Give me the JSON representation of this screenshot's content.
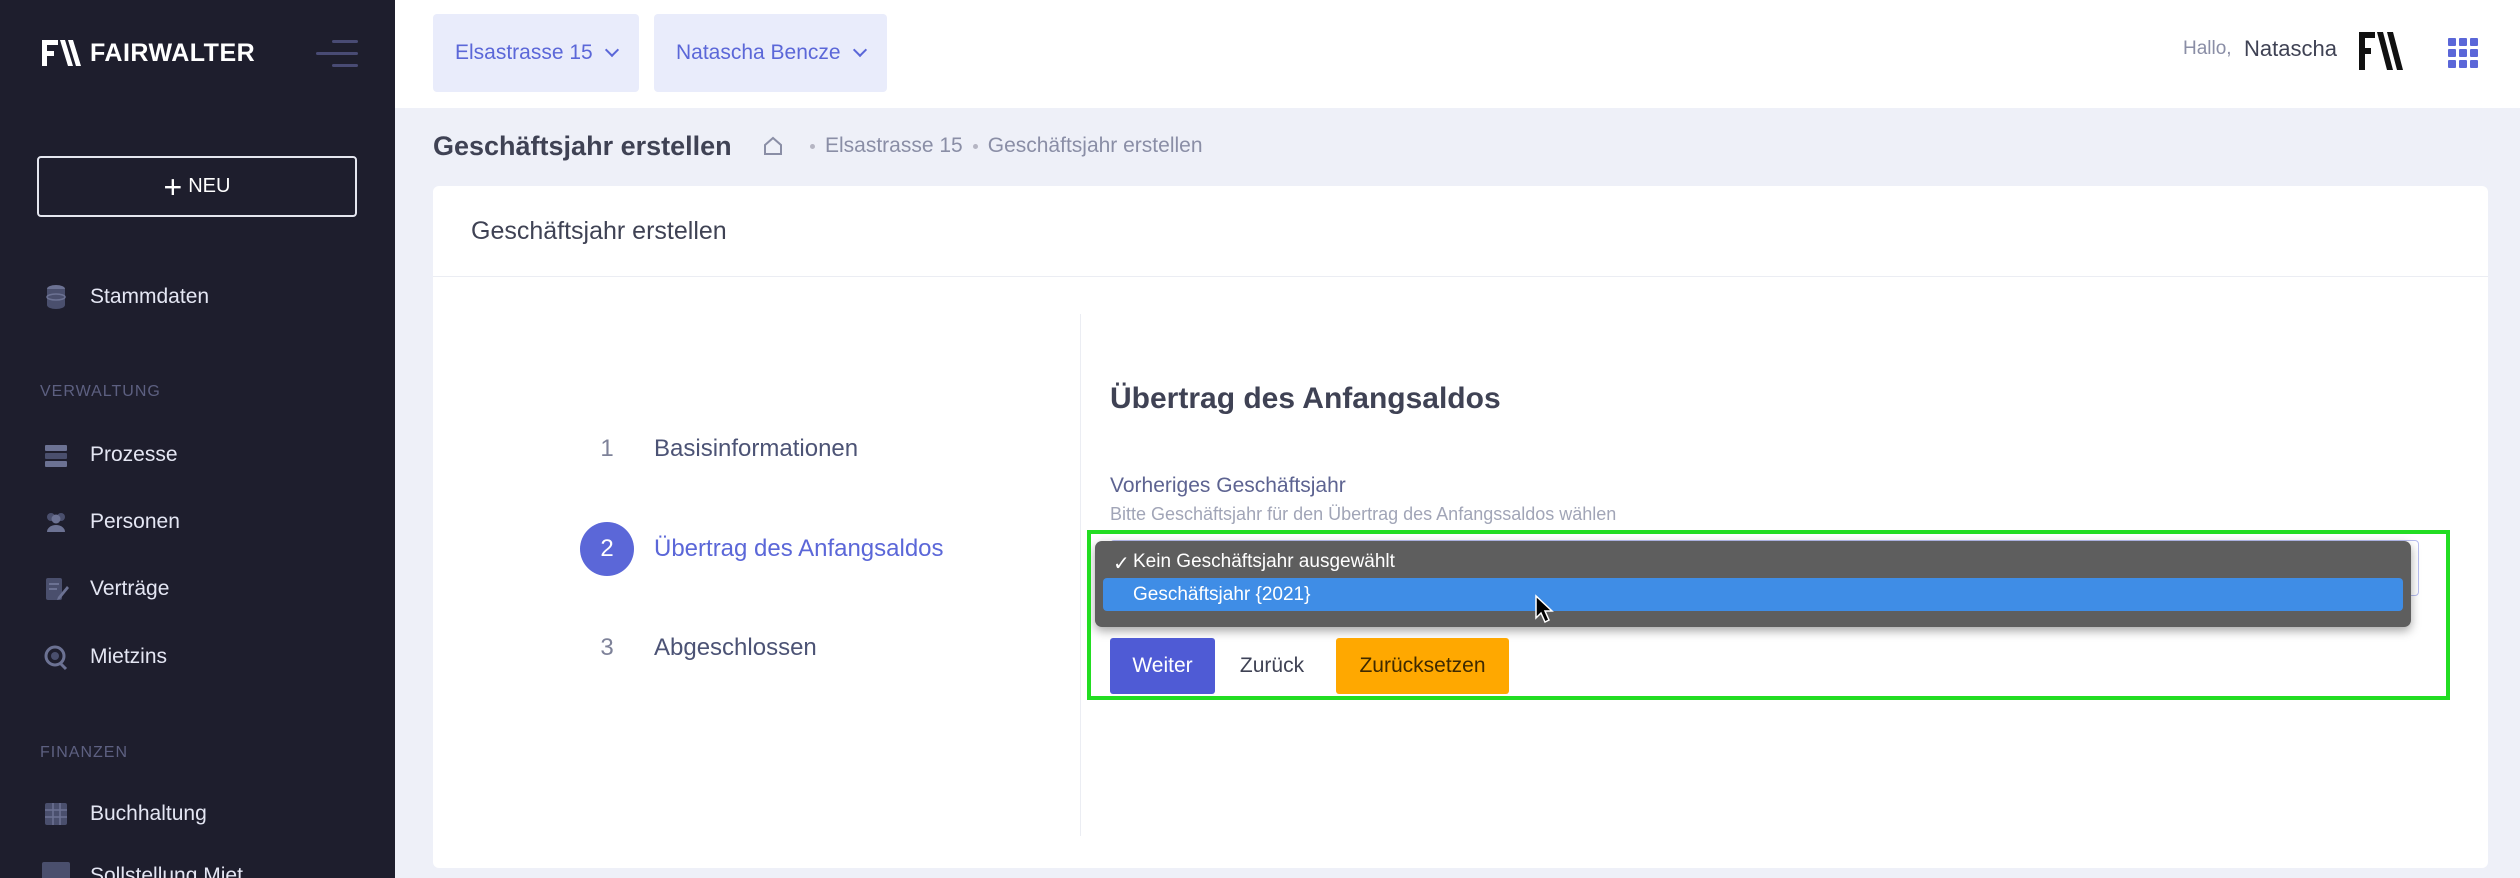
{
  "brand": {
    "name": "FAIRWALTER"
  },
  "sidebar": {
    "new_button": "NEU",
    "items": [
      {
        "label": "Stammdaten",
        "icon": "database-icon"
      },
      {
        "label": "Prozesse",
        "icon": "server-icon"
      },
      {
        "label": "Personen",
        "icon": "users-icon"
      },
      {
        "label": "Verträge",
        "icon": "contract-icon"
      },
      {
        "label": "Mietzins",
        "icon": "money-icon"
      },
      {
        "label": "Buchhaltung",
        "icon": "ledger-icon"
      },
      {
        "label": "Sollstellung Miet..."
      }
    ],
    "sections": {
      "verwaltung": "VERWALTUNG",
      "finanzen": "FINANZEN"
    }
  },
  "header": {
    "property_select": "Elsastrasse 15",
    "person_select": "Natascha Bencze",
    "greeting": "Hallo,",
    "user_name": "Natascha"
  },
  "subheader": {
    "title": "Geschäftsjahr erstellen",
    "breadcrumb": [
      "Elsastrasse 15",
      "Geschäftsjahr erstellen"
    ]
  },
  "card": {
    "title": "Geschäftsjahr erstellen",
    "steps": [
      {
        "num": "1",
        "label": "Basisinformationen"
      },
      {
        "num": "2",
        "label": "Übertrag des Anfangsaldos"
      },
      {
        "num": "3",
        "label": "Abgeschlossen"
      }
    ],
    "active_step": 2,
    "section_title": "Übertrag des Anfangsaldos",
    "field_label": "Vorheriges Geschäftsjahr",
    "field_help": "Bitte Geschäftsjahr für den Übertrag des Anfangssaldos wählen",
    "dropdown_options": [
      {
        "label": "Kein Geschäftsjahr ausgewählt",
        "checked": true
      },
      {
        "label": "Geschäftsjahr {2021}",
        "highlighted": true
      }
    ],
    "buttons": {
      "next": "Weiter",
      "back": "Zurück",
      "reset": "Zurücksetzen"
    }
  },
  "colors": {
    "accent": "#5b67d8",
    "sidebar_bg": "#1e1e2d",
    "warning": "#ffa800",
    "highlight_outline": "#22dd22"
  }
}
